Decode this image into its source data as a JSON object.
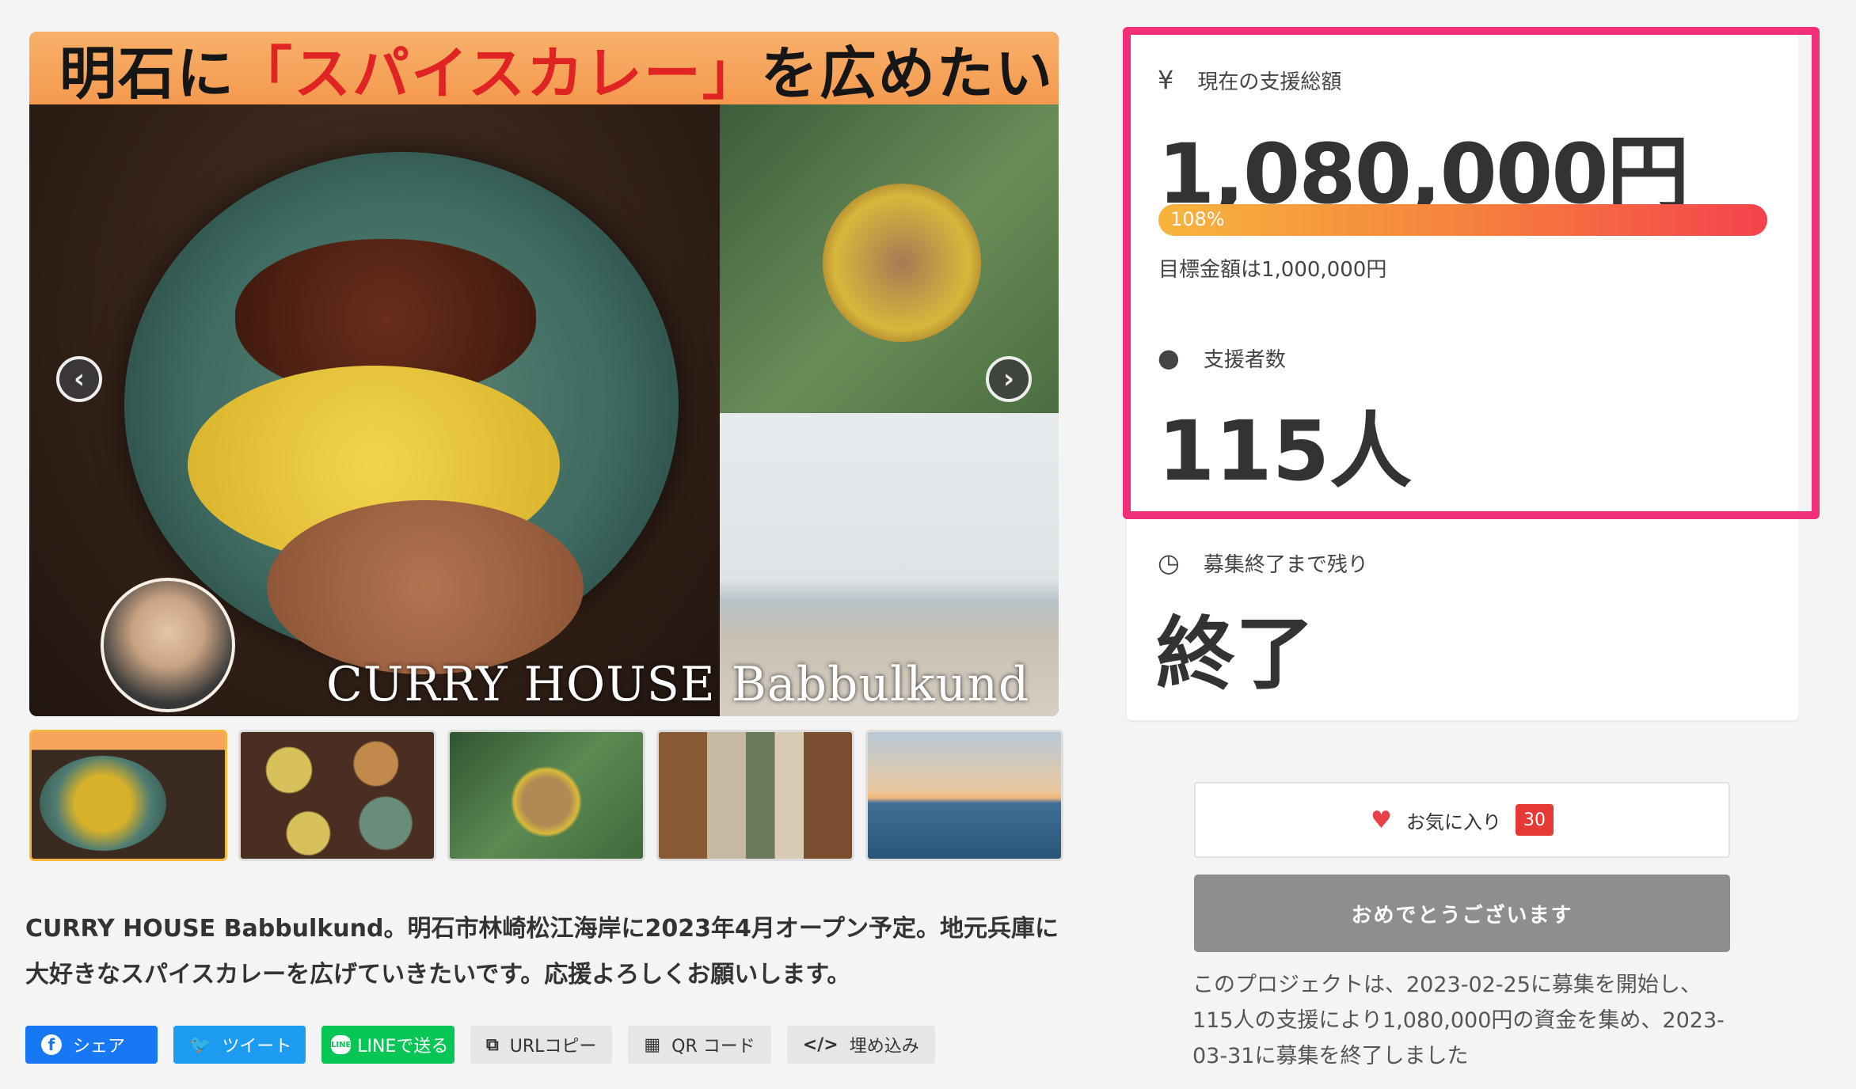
{
  "hero": {
    "banner_prefix": "明石に",
    "banner_highlight": "「スパイスカレー」",
    "banner_suffix": "を広めたい！",
    "caption": "CURRY HOUSE Babbulkund",
    "prev_icon": "chevron-left-icon",
    "next_icon": "chevron-right-icon"
  },
  "thumbnails": [
    {
      "active": true
    },
    {
      "active": false
    },
    {
      "active": false
    },
    {
      "active": false
    },
    {
      "active": false
    }
  ],
  "description": "CURRY HOUSE Babbulkund。明石市林崎松江海岸に2023年4月オープン予定。地元兵庫に大好きなスパイスカレーを広げていきたいです。応援よろしくお願いします。",
  "share": {
    "facebook": "シェア",
    "twitter": "ツイート",
    "line": "LINEで送る",
    "line_icon": "LINE",
    "url_copy": "URLコピー",
    "qr": "QR コード",
    "embed": "埋め込み"
  },
  "stats": {
    "total_label": "現在の支援総額",
    "total_icon": "¥",
    "total_amount": "1,080,000円",
    "progress_percent": 108,
    "progress_label": "108%",
    "goal_text": "目標金額は1,000,000円",
    "backers_label": "支援者数",
    "backers_count": "115人",
    "remaining_label": "募集終了まで残り",
    "remaining_value": "終了"
  },
  "favorite": {
    "label": "お気に入り",
    "count": "30"
  },
  "congrats_button": "おめでとうございます",
  "summary": "このプロジェクトは、2023-02-25に募集を開始し、115人の支援により1,080,000円の資金を集め、2023-03-31に募集を終了しました",
  "colors": {
    "highlight_border": "#ef2f78",
    "progress_start": "#f7b53d",
    "progress_end": "#f4424d",
    "favorite_badge": "#e53935",
    "congrats_button": "#8e8e8e"
  }
}
